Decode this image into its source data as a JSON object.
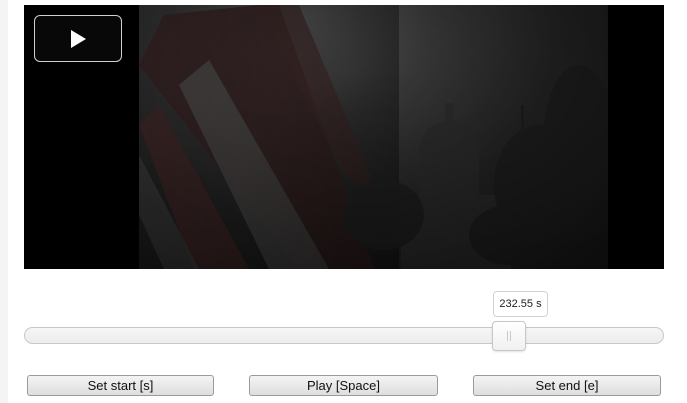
{
  "player": {
    "play_icon": "play-icon",
    "colors": {
      "letterbox": "#000000",
      "overlay_border": "#cfcfcf"
    }
  },
  "seek": {
    "current_value": "232.55",
    "unit": "s",
    "position_fraction": 0.7735
  },
  "controls": {
    "set_start_label": "Set start [s]",
    "play_label": "Play [Space]",
    "set_end_label": "Set end [e]"
  }
}
